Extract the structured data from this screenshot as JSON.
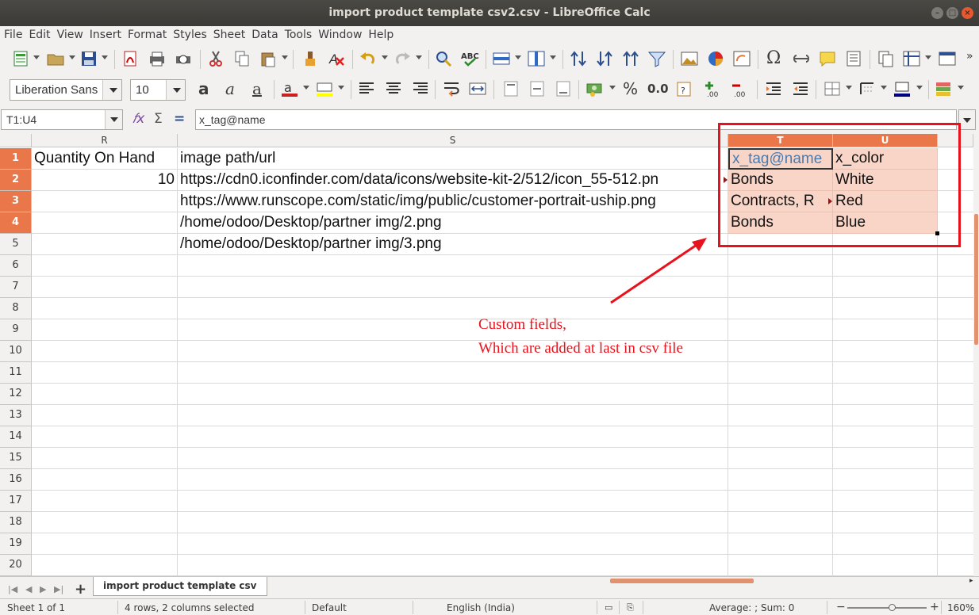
{
  "window": {
    "title": "import product template csv2.csv - LibreOffice Calc"
  },
  "menu": [
    "File",
    "Edit",
    "View",
    "Insert",
    "Format",
    "Styles",
    "Sheet",
    "Data",
    "Tools",
    "Window",
    "Help"
  ],
  "format_toolbar": {
    "font_name": "Liberation Sans",
    "font_size": "10",
    "percent_label": "%",
    "decimal_label": "0.0"
  },
  "formula_bar": {
    "name_box": "T1:U4",
    "content": "x_tag@name"
  },
  "columns": [
    {
      "label": "R",
      "selected": false
    },
    {
      "label": "S",
      "selected": false
    },
    {
      "label": "T",
      "selected": true
    },
    {
      "label": "U",
      "selected": true
    }
  ],
  "rows": [
    "1",
    "2",
    "3",
    "4",
    "5",
    "6",
    "7",
    "8",
    "9",
    "10",
    "11",
    "12",
    "13",
    "14",
    "15",
    "16",
    "17",
    "18",
    "19",
    "20"
  ],
  "cells": {
    "R1": "Quantity On Hand",
    "S1": "image path/url",
    "T1": "x_tag@name",
    "U1": "x_color",
    "R2": "10",
    "S2": "https://cdn0.iconfinder.com/data/icons/website-kit-2/512/icon_55-512.pn",
    "T2": "Bonds",
    "U2": "White",
    "S3": "https://www.runscope.com/static/img/public/customer-portrait-uship.png",
    "T3": "Contracts, R",
    "U3": "Red",
    "S4": "/home/odoo/Desktop/partner img/2.png",
    "T4": "Bonds",
    "U4": "Blue",
    "S5": "/home/odoo/Desktop/partner img/3.png"
  },
  "annotation": {
    "line1": "Custom fields,",
    "line2": "Which are added at last in csv file",
    "color": "#e8121c"
  },
  "sheet_tabs": [
    "import product template csv"
  ],
  "status_bar": {
    "sheet": "Sheet 1 of 1",
    "selection": "4 rows, 2 columns selected",
    "page_style": "Default",
    "language": "English (India)",
    "summary": "Average: ; Sum: 0",
    "zoom": "160%"
  },
  "colors": {
    "selection_header": "#e9774a",
    "selection_fill": "#f9d5c8"
  }
}
